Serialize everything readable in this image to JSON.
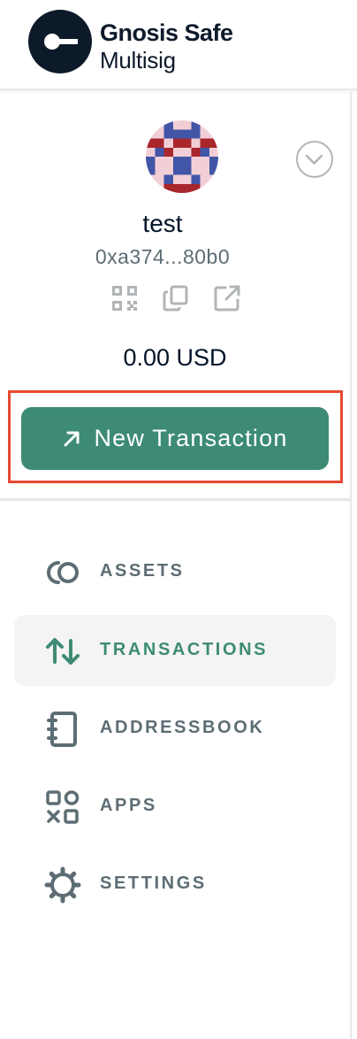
{
  "brand": {
    "line1": "Gnosis Safe",
    "line2": "Multisig",
    "logo_icon": "gnosis-safe-logo"
  },
  "safe": {
    "name": "test",
    "address": "0xa374...80b0",
    "balance": "0.00 USD",
    "actions": [
      "qr-code-icon",
      "copy-icon",
      "external-link-icon"
    ],
    "toggle_icon": "chevron-down-icon"
  },
  "new_transaction": {
    "label": "New Transaction",
    "icon": "arrow-up-right-icon"
  },
  "nav": [
    {
      "label": "ASSETS",
      "icon": "assets-icon",
      "active": false
    },
    {
      "label": "TRANSACTIONS",
      "icon": "transactions-icon",
      "active": true
    },
    {
      "label": "ADDRESSBOOK",
      "icon": "addressbook-icon",
      "active": false
    },
    {
      "label": "APPS",
      "icon": "apps-icon",
      "active": false
    },
    {
      "label": "SETTINGS",
      "icon": "settings-icon",
      "active": false
    }
  ],
  "colors": {
    "accent": "#3d8b75",
    "highlight": "#e74a32",
    "muted": "#5d6d74",
    "text": "#001428"
  }
}
